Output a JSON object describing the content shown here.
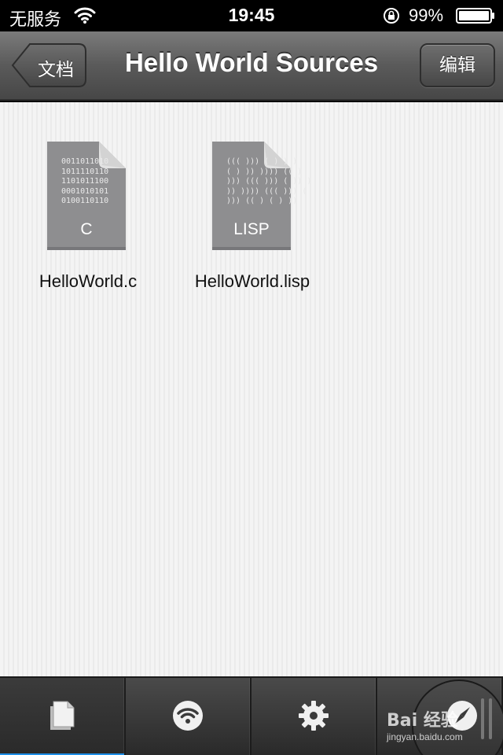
{
  "status_bar": {
    "carrier": "无服务",
    "time": "19:45",
    "battery_percent": "99%"
  },
  "nav_bar": {
    "back_label": "文档",
    "title": "Hello World Sources",
    "edit_label": "编辑"
  },
  "files": [
    {
      "name": "HelloWorld.c",
      "type_label": "C",
      "code_lines": "0011011010\n1011110110\n1101011100\n0001010101\n0100110110",
      "icon": "c-file-icon"
    },
    {
      "name": "HelloWorld.lisp",
      "type_label": "LISP",
      "code_lines": "((( ))) ( ) ) )\n( ) )) )))) (( )\n))) ((( ))) ( )) )\n)) )))) ((( ))) (\n))) (( ) ( ) ))",
      "icon": "lisp-file-icon"
    }
  ],
  "tab_bar": {
    "tabs": [
      {
        "name": "documents",
        "icon": "document-icon",
        "selected": true
      },
      {
        "name": "wifi",
        "icon": "wifi-icon",
        "selected": false
      },
      {
        "name": "settings",
        "icon": "gear-icon",
        "selected": false
      },
      {
        "name": "compass",
        "icon": "compass-icon",
        "selected": false
      }
    ]
  },
  "watermark": {
    "text": "Bai 经验",
    "url": "jingyan.baidu.com"
  },
  "colors": {
    "tab_selected_indicator": "#1e8fe8",
    "nav_bar": "#5a5a5a",
    "file_icon": "#8e8e90"
  }
}
